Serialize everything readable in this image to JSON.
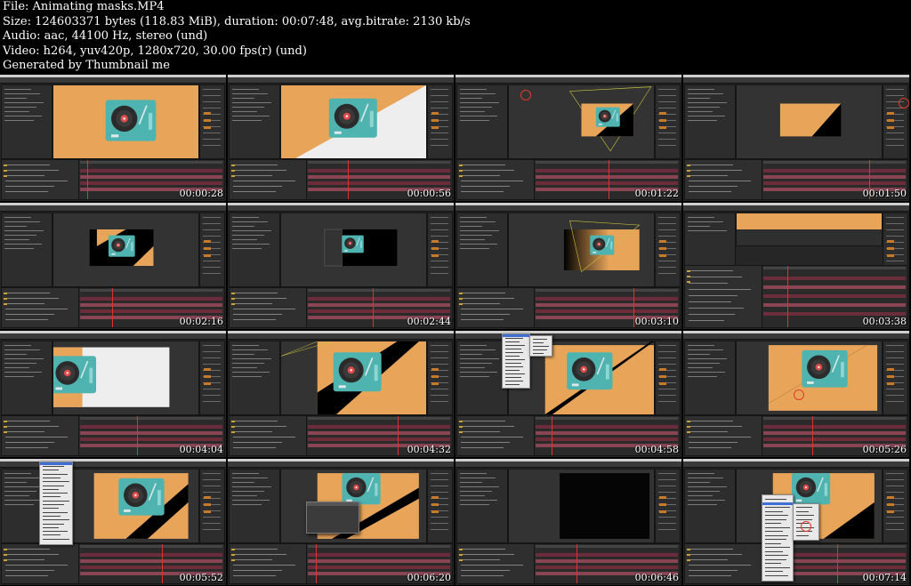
{
  "header": {
    "file_line": "File: Animating masks.MP4",
    "size_line": "Size: 124603371 bytes (118.83 MiB), duration: 00:07:48, avg.bitrate: 2130 kb/s",
    "audio_line": "Audio: aac, 44100 Hz, stereo (und)",
    "video_line": "Video: h264, yuv420p, 1280x720, 30.00 fps(r) (und)",
    "generator_line": "Generated by Thumbnail me"
  },
  "colors": {
    "orange": "#e8a55a",
    "turntable": "#4fb3b0",
    "timeline_bar": "#6b2d3a",
    "playhead": "#e03030"
  },
  "thumbnails": [
    {
      "timestamp": "00:00:28",
      "scene": "full-orange-turntable"
    },
    {
      "timestamp": "00:00:56",
      "scene": "diagonal-white-mask"
    },
    {
      "timestamp": "00:01:22",
      "scene": "small-mask-outline"
    },
    {
      "timestamp": "00:01:50",
      "scene": "orange-black-diagonal-small"
    },
    {
      "timestamp": "00:02:16",
      "scene": "black-frame-turntable-center"
    },
    {
      "timestamp": "00:02:44",
      "scene": "black-frame-turntable-left"
    },
    {
      "timestamp": "00:03:10",
      "scene": "gradient-mask"
    },
    {
      "timestamp": "00:03:38",
      "scene": "zoomed-timeline"
    },
    {
      "timestamp": "00:04:04",
      "scene": "white-bg-turntable-left"
    },
    {
      "timestamp": "00:04:32",
      "scene": "black-stripe-diagonal"
    },
    {
      "timestamp": "00:04:58",
      "scene": "context-menu-open"
    },
    {
      "timestamp": "00:05:26",
      "scene": "red-cursor-circle"
    },
    {
      "timestamp": "00:05:52",
      "scene": "file-menu-open"
    },
    {
      "timestamp": "00:06:20",
      "scene": "dialog-open"
    },
    {
      "timestamp": "00:06:46",
      "scene": "black-composition"
    },
    {
      "timestamp": "00:07:14",
      "scene": "layer-context-menu"
    }
  ]
}
